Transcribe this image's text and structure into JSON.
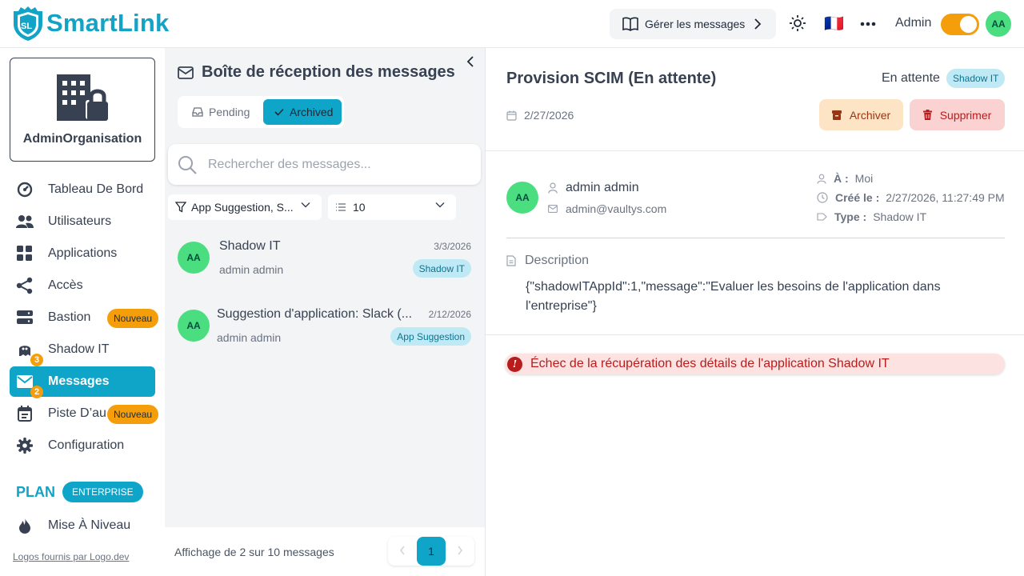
{
  "header": {
    "logo_text": "SmartLink",
    "logo_initials": "SL",
    "manage_label": "Gérer les messages",
    "flag": "🇫🇷",
    "admin_label": "Admin",
    "avatar_initials": "AA",
    "accent_color": "#12a3c6"
  },
  "sidebar": {
    "org_name": "AdminOrganisation",
    "items": [
      {
        "label": "Tableau De Bord",
        "icon": "dashboard-icon"
      },
      {
        "label": "Utilisateurs",
        "icon": "users-icon"
      },
      {
        "label": "Applications",
        "icon": "apps-grid-icon"
      },
      {
        "label": "Accès",
        "icon": "share-icon"
      },
      {
        "label": "Bastion",
        "icon": "server-icon",
        "badge": "Nouveau"
      },
      {
        "label": "Shadow IT",
        "icon": "ghost-icon",
        "count": "3"
      },
      {
        "label": "Messages",
        "icon": "mail-icon",
        "count": "2",
        "active": true
      },
      {
        "label": "Piste D’au",
        "icon": "calendar-icon",
        "badge": "Nouveau"
      },
      {
        "label": "Configuration",
        "icon": "gear-icon"
      }
    ],
    "plan_label": "PLAN",
    "plan_badge": "ENTERPRISE",
    "upgrade_label": "Mise À Niveau",
    "logos_link": "Logos fournis par Logo.dev"
  },
  "inbox": {
    "title": "Boîte de réception des messages",
    "tabs": [
      {
        "label": "Pending",
        "active": false
      },
      {
        "label": "Archived",
        "active": true
      }
    ],
    "search_placeholder": "Rechercher des messages...",
    "filter_value": "App Suggestion, S...",
    "page_size": "10",
    "messages": [
      {
        "initials": "AA",
        "subject": "Shadow IT",
        "sender": "admin admin",
        "date": "3/3/2026",
        "tag": "Shadow IT"
      },
      {
        "initials": "AA",
        "subject": "Suggestion d'application: Slack (...",
        "sender": "admin admin",
        "date": "2/12/2026",
        "tag": "App Suggestion"
      }
    ],
    "showing_text": "Affichage de 2 sur 10 messages",
    "current_page": "1"
  },
  "detail": {
    "title": "Provision SCIM (En attente)",
    "status": "En attente",
    "tag": "Shadow IT",
    "date": "2/27/2026",
    "archive_label": "Archiver",
    "delete_label": "Supprimer",
    "sender_initials": "AA",
    "sender_name": "admin admin",
    "sender_email": "admin@vaultys.com",
    "to_label": "À :",
    "to_value": "Moi",
    "created_label": "Créé le :",
    "created_value": "2/27/2026, 11:27:49 PM",
    "type_label": "Type :",
    "type_value": "Shadow IT",
    "description_label": "Description",
    "description_text": "{\"shadowITAppId\":1,\"message\":\"Evaluer les besoins de l'application dans l'entreprise\"}",
    "error_icon": "!",
    "error_text": "Échec de la récupération des détails de l'application Shadow IT"
  }
}
